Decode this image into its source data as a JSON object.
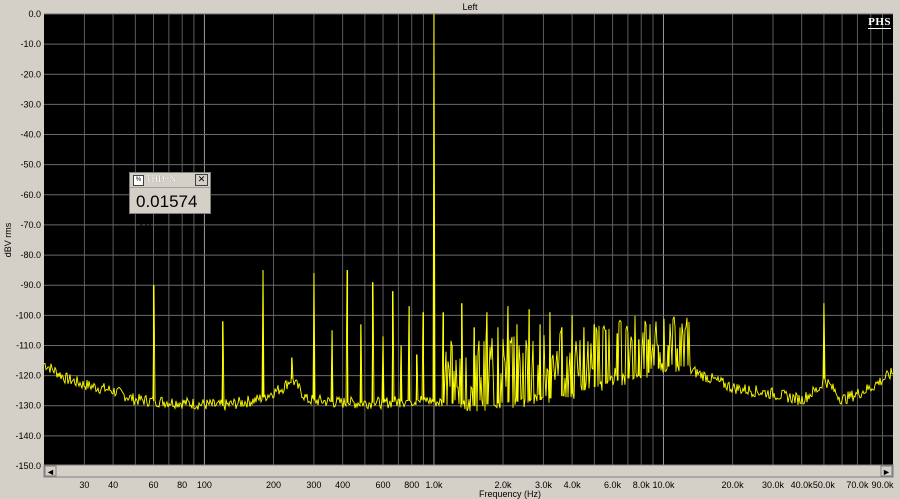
{
  "chart_data": {
    "type": "line",
    "title": "Left",
    "xlabel": "Frequency (Hz)",
    "ylabel": "dBV rms",
    "xscale": "log",
    "xlim": [
      20,
      100000
    ],
    "ylim": [
      -150,
      0
    ],
    "grid": true,
    "yticks": [
      0,
      -10,
      -20,
      -30,
      -40,
      -50,
      -60,
      -70,
      -80,
      -90,
      -100,
      -110,
      -120,
      -130,
      -140,
      -150
    ],
    "ytick_labels": [
      "0.0",
      "-10.0",
      "-20.0",
      "-30.0",
      "-40.0",
      "-50.0",
      "-60.0",
      "-70.0",
      "-80.0",
      "-90.0",
      "-100.0",
      "-110.0",
      "-120.0",
      "-130.0",
      "-140.0",
      "-150.0"
    ],
    "xticks": [
      30,
      40,
      60,
      80,
      100,
      200,
      300,
      400,
      600,
      800,
      1000,
      2000,
      3000,
      4000,
      6000,
      8000,
      10000,
      20000,
      30000,
      40000,
      50000,
      70000,
      90000
    ],
    "xtick_labels": [
      "30",
      "40",
      "60",
      "80",
      "100",
      "200",
      "300",
      "400",
      "600",
      "800",
      "1.0k",
      "2.0k",
      "3.0k",
      "4.0k",
      "6.0k",
      "8.0k",
      "10.0k",
      "20.0k",
      "30.0k",
      "40.0k",
      "50.0k",
      "70.0k",
      "90.0k"
    ],
    "series": [
      {
        "color": "#ffff00",
        "baseline": [
          [
            20,
            -116
          ],
          [
            25,
            -121
          ],
          [
            30,
            -123
          ],
          [
            40,
            -125
          ],
          [
            50,
            -128
          ],
          [
            80,
            -129
          ],
          [
            120,
            -130
          ],
          [
            170,
            -128
          ],
          [
            220,
            -124
          ],
          [
            240,
            -121
          ],
          [
            280,
            -128
          ],
          [
            400,
            -129
          ],
          [
            600,
            -129
          ],
          [
            900,
            -128
          ],
          [
            1100,
            -129
          ],
          [
            1500,
            -130
          ],
          [
            2000,
            -129
          ],
          [
            3000,
            -128
          ],
          [
            4000,
            -126
          ],
          [
            6000,
            -122
          ],
          [
            8000,
            -120
          ],
          [
            10000,
            -117
          ],
          [
            12000,
            -117
          ],
          [
            15000,
            -120
          ],
          [
            20000,
            -124
          ],
          [
            30000,
            -126
          ],
          [
            40000,
            -128
          ],
          [
            48000,
            -124
          ],
          [
            50000,
            -121
          ],
          [
            60000,
            -128
          ],
          [
            70000,
            -126
          ],
          [
            80000,
            -124
          ],
          [
            100000,
            -119
          ]
        ],
        "peaks": [
          [
            60,
            -90
          ],
          [
            120,
            -102
          ],
          [
            180,
            -85
          ],
          [
            240,
            -114
          ],
          [
            300,
            -86
          ],
          [
            360,
            -105
          ],
          [
            420,
            -85
          ],
          [
            480,
            -103
          ],
          [
            540,
            -89
          ],
          [
            600,
            -107
          ],
          [
            660,
            -92
          ],
          [
            720,
            -110
          ],
          [
            780,
            -97
          ],
          [
            840,
            -113
          ],
          [
            900,
            -99
          ],
          [
            1000,
            0
          ],
          [
            1100,
            -99
          ],
          [
            1200,
            -110
          ],
          [
            1320,
            -96
          ],
          [
            1500,
            -104
          ],
          [
            1700,
            -99
          ],
          [
            1900,
            -104
          ],
          [
            2100,
            -97
          ],
          [
            2300,
            -103
          ],
          [
            2600,
            -98
          ],
          [
            2900,
            -103
          ],
          [
            3200,
            -99
          ],
          [
            3600,
            -104
          ],
          [
            4000,
            -100
          ],
          [
            4500,
            -104
          ],
          [
            5000,
            -103
          ],
          [
            5600,
            -105
          ],
          [
            6300,
            -106
          ],
          [
            7000,
            -106
          ],
          [
            7800,
            -108
          ],
          [
            8600,
            -108
          ],
          [
            9500,
            -110
          ],
          [
            10500,
            -110
          ],
          [
            11500,
            -111
          ],
          [
            50000,
            -96
          ]
        ]
      }
    ]
  },
  "thd_panel": {
    "title": "THD+N",
    "value": "0.01574 %",
    "close": "✕"
  },
  "watermark": "PHS",
  "scrollbar": {
    "left_arrow": "◄",
    "right_arrow": "►"
  }
}
